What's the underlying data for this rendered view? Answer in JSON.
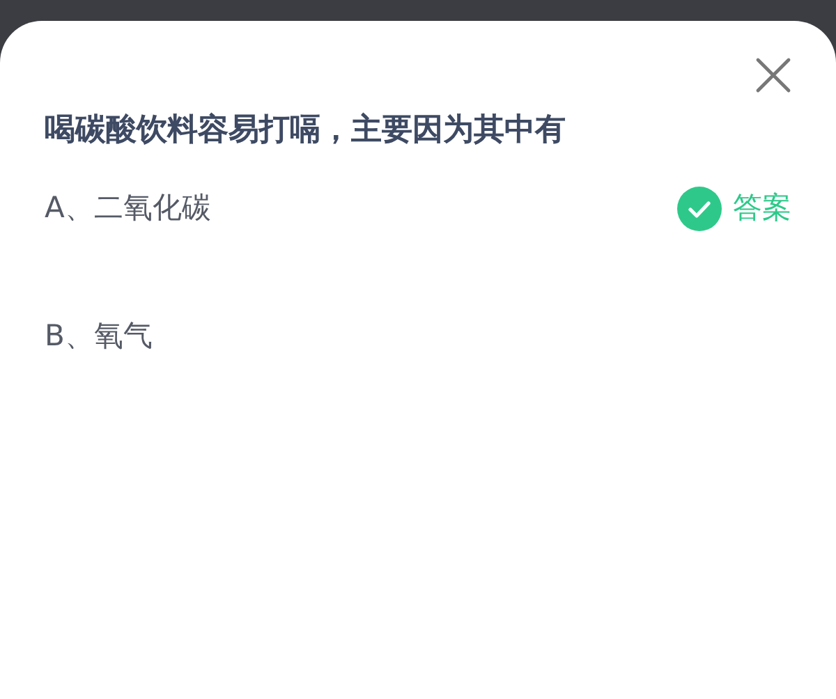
{
  "question": "喝碳酸饮料容易打嗝，主要因为其中有",
  "options": [
    {
      "text": "A、二氧化碳",
      "correct": true,
      "badge": "答案"
    },
    {
      "text": "B、氧气",
      "correct": false
    }
  ]
}
